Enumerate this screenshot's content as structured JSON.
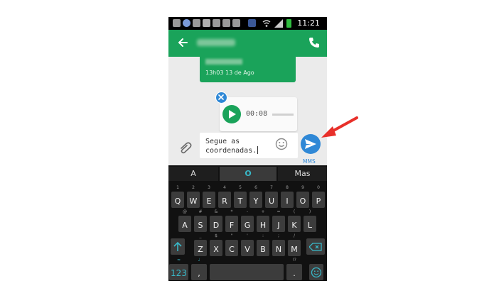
{
  "statusbar": {
    "time": "11:21"
  },
  "conversation": {
    "message_time": "13h03 13 de Ago",
    "audio_duration": "00:08"
  },
  "compose": {
    "text_line1": "Segue as",
    "text_line2": "coordenadas.",
    "send_type": "MMS"
  },
  "keyboard": {
    "suggestions": [
      "A",
      "O",
      "Mas"
    ],
    "row1": [
      {
        "key": "Q",
        "alt": "1"
      },
      {
        "key": "W",
        "alt": "2"
      },
      {
        "key": "E",
        "alt": "3"
      },
      {
        "key": "R",
        "alt": "4"
      },
      {
        "key": "T",
        "alt": "5"
      },
      {
        "key": "Y",
        "alt": "6"
      },
      {
        "key": "U",
        "alt": "7"
      },
      {
        "key": "I",
        "alt": "8"
      },
      {
        "key": "O",
        "alt": "9"
      },
      {
        "key": "P",
        "alt": "0"
      }
    ],
    "row2": [
      {
        "key": "A",
        "alt": "@"
      },
      {
        "key": "S",
        "alt": "#"
      },
      {
        "key": "D",
        "alt": "&"
      },
      {
        "key": "F",
        "alt": "*"
      },
      {
        "key": "G",
        "alt": "-"
      },
      {
        "key": "H",
        "alt": "+"
      },
      {
        "key": "J",
        "alt": "="
      },
      {
        "key": "K",
        "alt": "("
      },
      {
        "key": "L",
        "alt": ")"
      }
    ],
    "row3": [
      {
        "key": "Z",
        "alt": "_"
      },
      {
        "key": "X",
        "alt": "$"
      },
      {
        "key": "C",
        "alt": "\""
      },
      {
        "key": "V",
        "alt": "'"
      },
      {
        "key": "B",
        "alt": ":"
      },
      {
        "key": "N",
        "alt": ";"
      },
      {
        "key": "M",
        "alt": "/"
      }
    ],
    "numbers_key": "123",
    "comma_key": ",",
    "period_key": "."
  },
  "colors": {
    "app_green": "#1aa35a",
    "accent_blue": "#2f88d6",
    "keyboard_bg": "#111111",
    "arrow_red": "#e8302a"
  }
}
